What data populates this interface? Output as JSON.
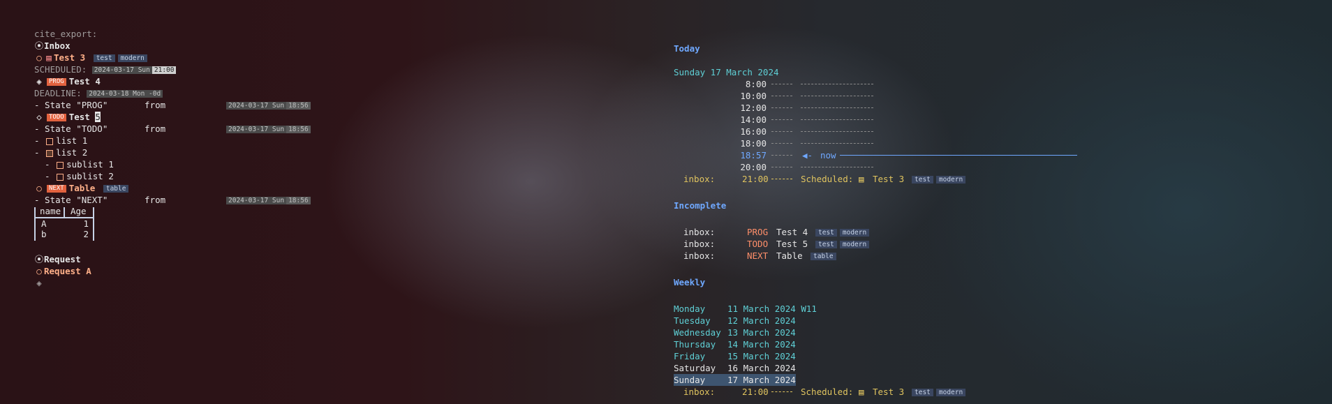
{
  "left": {
    "file": "cite_export:",
    "inbox": {
      "bullet": "⦿",
      "title": "Inbox"
    },
    "test3": {
      "bullet": "○",
      "title": "Test 3",
      "tags": [
        "test",
        "modern"
      ]
    },
    "scheduled": {
      "label": "SCHEDULED:",
      "date": "2024-03-17 Sun",
      "time": "21:00"
    },
    "test4": {
      "bullet": "◈",
      "keyword": "PROG",
      "title": "Test 4"
    },
    "deadline": {
      "label": "DEADLINE:",
      "date": "2024-03-18 Mon -0d"
    },
    "state_prog": {
      "text": "- State \"PROG\"       from",
      "date": "2024-03-17 Sun",
      "time": "18:56"
    },
    "test5": {
      "bullet": "◇",
      "keyword": "TODO",
      "title": "Test ",
      "cursor": "5"
    },
    "state_todo": {
      "text": "- State \"TODO\"       from",
      "date": "2024-03-17 Sun",
      "time": "18:56"
    },
    "list1": {
      "prefix": "- ",
      "label": "list 1"
    },
    "list2": {
      "prefix": "- ",
      "label": "list 2"
    },
    "sublist1": {
      "prefix": "  - ",
      "label": "sublist 1"
    },
    "sublist2": {
      "prefix": "  - ",
      "label": "sublist 2"
    },
    "table_item": {
      "bullet": "○",
      "keyword": "NEXT",
      "title": "Table",
      "tag": "table"
    },
    "state_next": {
      "text": "- State \"NEXT\"       from",
      "date": "2024-03-17 Sun",
      "time": "18:56"
    },
    "table": {
      "headers": [
        "name",
        "Age"
      ],
      "rows": [
        [
          "A",
          "1"
        ],
        [
          "b",
          "2"
        ]
      ]
    },
    "request": {
      "bullet": "⦿",
      "title": "Request"
    },
    "request_a": {
      "bullet": "○",
      "title": "Request A"
    },
    "empty_bullet": "◈"
  },
  "agenda": {
    "today_heading": "Today",
    "date_line": "Sunday 17 March 2024",
    "times": [
      "8:00",
      "10:00",
      "12:00",
      "14:00",
      "16:00",
      "18:00"
    ],
    "now_time": "18:57",
    "now_label": "now",
    "time_2000": "20:00",
    "sched_inbox": "inbox:",
    "sched_time": "21:00",
    "sched_label": "Scheduled:",
    "sched_title": "Test 3",
    "sched_tags": [
      "test",
      "modern"
    ],
    "incomplete_heading": "Incomplete",
    "incomplete": [
      {
        "cat": "inbox:",
        "kw": "PROG",
        "title": "Test 4",
        "tags": [
          "test",
          "modern"
        ]
      },
      {
        "cat": "inbox:",
        "kw": "TODO",
        "title": "Test 5",
        "tags": [
          "test",
          "modern"
        ]
      },
      {
        "cat": "inbox:",
        "kw": "NEXT",
        "title": "Table",
        "tags": [
          "table"
        ]
      }
    ],
    "weekly_heading": "Weekly",
    "week": [
      {
        "day": "Monday",
        "date": "11 March 2024 W11"
      },
      {
        "day": "Tuesday",
        "date": "12 March 2024"
      },
      {
        "day": "Wednesday",
        "date": "13 March 2024"
      },
      {
        "day": "Thursday",
        "date": "14 March 2024"
      },
      {
        "day": "Friday",
        "date": "15 March 2024"
      },
      {
        "day": "Saturday",
        "date": "16 March 2024"
      },
      {
        "day": "Sunday",
        "date": "17 March 2024"
      }
    ],
    "weekly_sched": {
      "cat": "inbox:",
      "time": "21:00",
      "label": "Scheduled:",
      "title": "Test 3",
      "tags": [
        "test",
        "modern"
      ]
    }
  },
  "colors": {
    "heading": "#6fa8ff",
    "todo_kw": "#e2623f",
    "cyan": "#5fd0d6",
    "tag_bg": "#3a4660"
  }
}
